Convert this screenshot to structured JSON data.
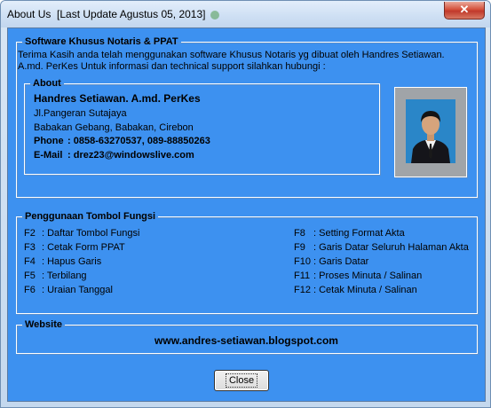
{
  "window": {
    "title": "About Us  [Last Update Agustus 05, 2013]",
    "close_glyph": "✕"
  },
  "software": {
    "legend": "Software Khusus Notaris & PPAT",
    "line1": "Terima Kasih anda telah menggunakan software Khusus Notaris yg dibuat oleh Handres Setiawan.",
    "line2": "A.md. PerKes Untuk informasi dan technical support silahkan hubungi :"
  },
  "about": {
    "legend": "About",
    "name": "Handres Setiawan. A.md. PerKes",
    "address1": "Jl.Pangeran Sutajaya",
    "address2": "Babakan Gebang, Babakan, Cirebon",
    "phone_label": "Phone",
    "phone_value": ": 0858-63270537, 089-88850263",
    "email_label": "E-Mail",
    "email_value": ": drez23@windowslive.com"
  },
  "shortcuts": {
    "legend": "Penggunaan Tombol Fungsi",
    "left": [
      {
        "key": "F2",
        "desc": ": Daftar Tombol Fungsi"
      },
      {
        "key": "F3",
        "desc": ": Cetak Form PPAT"
      },
      {
        "key": "F4",
        "desc": ": Hapus Garis"
      },
      {
        "key": "F5",
        "desc": ": Terbilang"
      },
      {
        "key": "F6",
        "desc": ": Uraian Tanggal"
      }
    ],
    "right": [
      {
        "key": "F8",
        "desc": ": Setting Format Akta"
      },
      {
        "key": "F9",
        "desc": ": Garis Datar Seluruh Halaman Akta"
      },
      {
        "key": "F10",
        "desc": ": Garis Datar"
      },
      {
        "key": "F11",
        "desc": ": Proses Minuta / Salinan"
      },
      {
        "key": "F12",
        "desc": ": Cetak Minuta / Salinan"
      }
    ]
  },
  "website": {
    "legend": "Website",
    "url": "www.andres-setiawan.blogspot.com"
  },
  "buttons": {
    "close_label": "Close"
  },
  "icons": [
    "close-icon",
    "profile-photo"
  ],
  "colors": {
    "client_bg": "#3d91f0",
    "group_border": "#ffffff",
    "titlebar": "#cfe0f4",
    "close_button": "#c0392b"
  }
}
